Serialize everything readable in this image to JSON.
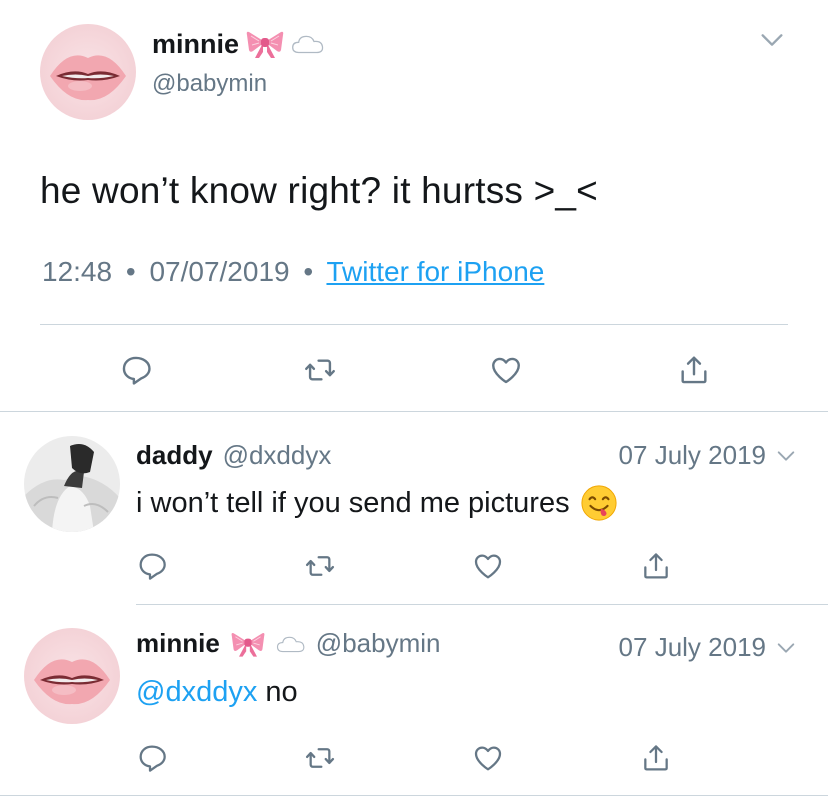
{
  "main_tweet": {
    "author_name": "minnie",
    "author_handle": "@babymin",
    "author_emojis": [
      "ribbon-emoji",
      "cloud-emoji"
    ],
    "text": "he won’t know right? it hurtss >_<",
    "time": "12:48",
    "separator": "•",
    "date": "07/07/2019",
    "source": "Twitter for iPhone"
  },
  "replies": [
    {
      "author_name": "daddy",
      "author_handle": "@dxddyx",
      "date": "07 July 2019",
      "text": "i won’t tell if you send me pictures",
      "trailing_emoji": "yum-face-emoji"
    },
    {
      "author_name": "minnie",
      "author_handle": "@babymin",
      "author_emojis": [
        "ribbon-emoji",
        "cloud-emoji"
      ],
      "date": "07 July 2019",
      "mention": "@dxddyx",
      "text": "no"
    }
  ],
  "icons": {
    "reply": "reply-icon",
    "retweet": "retweet-icon",
    "like": "like-icon",
    "share": "share-icon",
    "menu": "chevron-down-icon"
  },
  "colors": {
    "text": "#14171a",
    "secondary": "#657786",
    "link": "#1da1f2",
    "divider": "#ccd6dd"
  }
}
